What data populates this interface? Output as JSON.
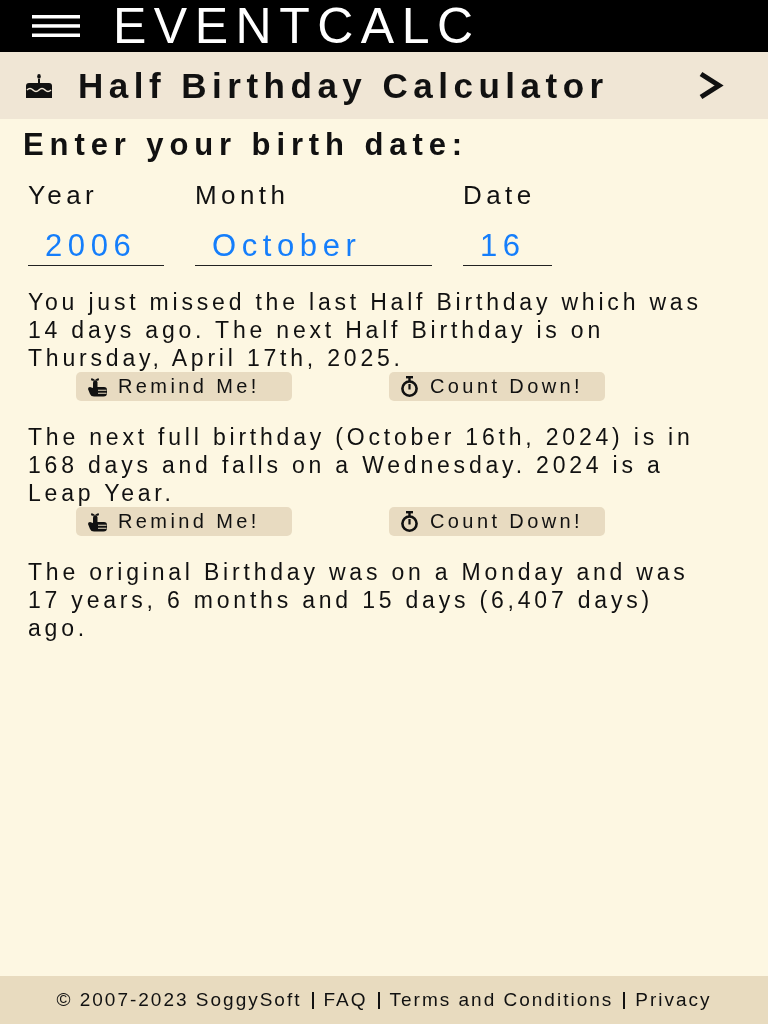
{
  "app_bar": {
    "title": "EVENTCALC"
  },
  "page_header": {
    "title": "Half Birthday Calculator"
  },
  "form": {
    "heading": "Enter your birth date:",
    "fields": [
      {
        "label": "Year",
        "value": "2006"
      },
      {
        "label": "Month",
        "value": "October"
      },
      {
        "label": "Date",
        "value": "16"
      }
    ]
  },
  "results": [
    {
      "text": "You just missed the last Half Birthday which was 14 days ago. The next Half Birthday is on Thursday, April 17th, 2025.",
      "buttons": [
        {
          "kind": "remind",
          "label": "Remind Me!"
        },
        {
          "kind": "countdown",
          "label": "Count Down!"
        }
      ]
    },
    {
      "text": "The next full birthday (October 16th, 2024) is in 168 days and falls on a Wednesday. 2024 is a Leap Year.",
      "buttons": [
        {
          "kind": "remind",
          "label": "Remind Me!"
        },
        {
          "kind": "countdown",
          "label": "Count Down!"
        }
      ]
    },
    {
      "text": "The original Birthday was on a Monday and was 17 years, 6 months and 15 days (6,407 days) ago."
    }
  ],
  "footer": {
    "copyright": "© 2007-2023 SoggySoft",
    "links": [
      "FAQ",
      "Terms and Conditions",
      "Privacy"
    ]
  }
}
